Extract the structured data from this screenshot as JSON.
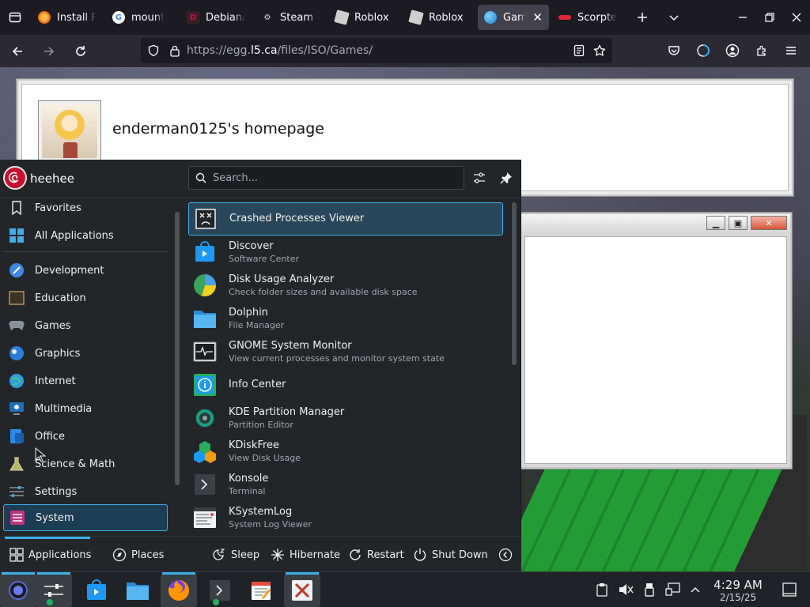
{
  "browser": {
    "tabs": [
      {
        "title": "Install F",
        "favicon": "firefox-icon",
        "color": "#e66000"
      },
      {
        "title": "mount",
        "favicon": "google-icon",
        "color": "#4285f4"
      },
      {
        "title": "Debian/",
        "favicon": "debian-icon",
        "color": "#d70751"
      },
      {
        "title": "Steam —",
        "favicon": "steam-icon",
        "color": "#c7d5e0"
      },
      {
        "title": "Roblox",
        "favicon": "roblox-icon",
        "color": "#cfcfcf"
      },
      {
        "title": "Roblox",
        "favicon": "roblox-icon",
        "color": "#cfcfcf"
      },
      {
        "title": "Game",
        "favicon": "globe-icon",
        "color": "#3daee9",
        "active": true
      },
      {
        "title": "Scorpte",
        "favicon": "scorpte-icon",
        "color": "#e0243a"
      }
    ],
    "url": {
      "host": "https://egg.",
      "domain": "l5.ca",
      "path": "/files/ISO/Games/"
    }
  },
  "webpage": {
    "homepage_title": "enderman0125's homepage"
  },
  "kde_menu": {
    "user_name": "heehee",
    "search_placeholder": "Search...",
    "categories": [
      {
        "label": "Favorites",
        "icon": "bookmark-icon"
      },
      {
        "label": "All Applications",
        "icon": "grid-icon"
      },
      {
        "label": "Development",
        "icon": "development-icon"
      },
      {
        "label": "Education",
        "icon": "education-icon"
      },
      {
        "label": "Games",
        "icon": "gamepad-icon"
      },
      {
        "label": "Graphics",
        "icon": "graphics-icon"
      },
      {
        "label": "Internet",
        "icon": "globe-icon"
      },
      {
        "label": "Multimedia",
        "icon": "multimedia-icon"
      },
      {
        "label": "Office",
        "icon": "office-icon"
      },
      {
        "label": "Science & Math",
        "icon": "science-icon"
      },
      {
        "label": "Settings",
        "icon": "settings-icon"
      },
      {
        "label": "System",
        "icon": "system-icon",
        "selected": true
      }
    ],
    "apps": [
      {
        "name": "Crashed Processes Viewer",
        "desc": "",
        "icon": "crash-icon",
        "highlighted": true
      },
      {
        "name": "Discover",
        "desc": "Software Center",
        "icon": "discover-icon"
      },
      {
        "name": "Disk Usage Analyzer",
        "desc": "Check folder sizes and available disk space",
        "icon": "pie-icon"
      },
      {
        "name": "Dolphin",
        "desc": "File Manager",
        "icon": "folder-icon"
      },
      {
        "name": "GNOME System Monitor",
        "desc": "View current processes and monitor system state",
        "icon": "monitor-icon"
      },
      {
        "name": "Info Center",
        "desc": "",
        "icon": "info-icon"
      },
      {
        "name": "KDE Partition Manager",
        "desc": "Partition Editor",
        "icon": "partition-icon"
      },
      {
        "name": "KDiskFree",
        "desc": "View Disk Usage",
        "icon": "kdiskfree-icon"
      },
      {
        "name": "Konsole",
        "desc": "Terminal",
        "icon": "terminal-icon"
      },
      {
        "name": "KSystemLog",
        "desc": "System Log Viewer",
        "icon": "log-icon"
      }
    ],
    "footer": {
      "applications": "Applications",
      "places": "Places",
      "sleep": "Sleep",
      "hibernate": "Hibernate",
      "restart": "Restart",
      "shutdown": "Shut Down"
    }
  },
  "taskbar": {
    "clock_time": "4:29 AM",
    "clock_date": "2/15/25"
  },
  "colors": {
    "accent": "#3daee9",
    "panel": "#232629"
  }
}
